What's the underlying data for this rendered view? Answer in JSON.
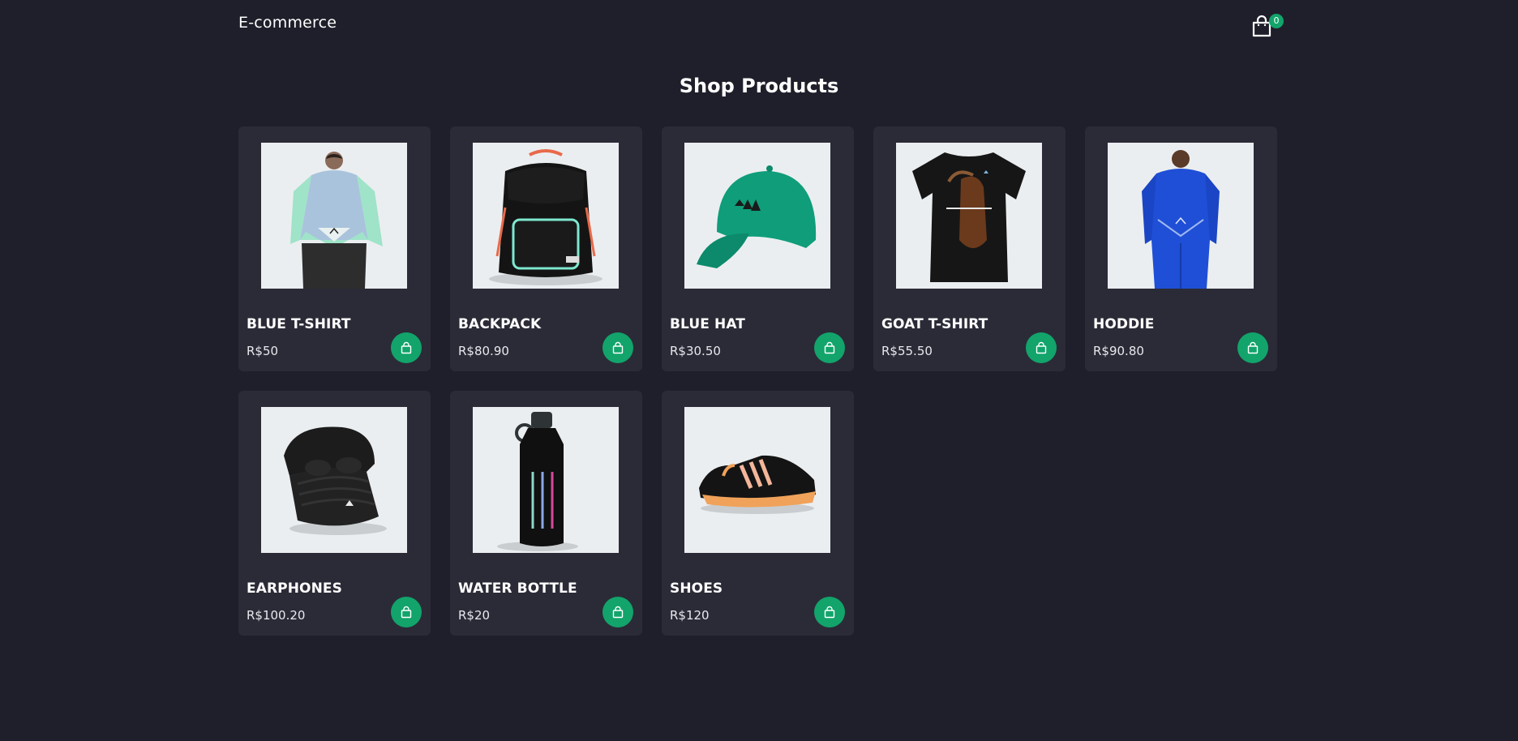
{
  "header": {
    "logo": "E-commerce",
    "cart_count": "0"
  },
  "page": {
    "title": "Shop Products"
  },
  "products": [
    {
      "name": "BLUE T-SHIRT",
      "price": "R$50",
      "image_icon": "blue-hoodie-image"
    },
    {
      "name": "BACKPACK",
      "price": "R$80.90",
      "image_icon": "backpack-image"
    },
    {
      "name": "BLUE HAT",
      "price": "R$30.50",
      "image_icon": "green-cap-image"
    },
    {
      "name": "GOAT T-SHIRT",
      "price": "R$55.50",
      "image_icon": "goat-tshirt-image"
    },
    {
      "name": "HODDIE",
      "price": "R$90.80",
      "image_icon": "blue-hoodie-model-image"
    },
    {
      "name": "EARPHONES",
      "price": "R$100.20",
      "image_icon": "earbuds-case-image"
    },
    {
      "name": "WATER BOTTLE",
      "price": "R$20",
      "image_icon": "water-bottle-image"
    },
    {
      "name": "SHOES",
      "price": "R$120",
      "image_icon": "sneaker-image"
    }
  ],
  "colors": {
    "background": "#1f1f2b",
    "card": "#2b2b37",
    "accent": "#12a46b",
    "image_bg": "#ebeef0"
  }
}
